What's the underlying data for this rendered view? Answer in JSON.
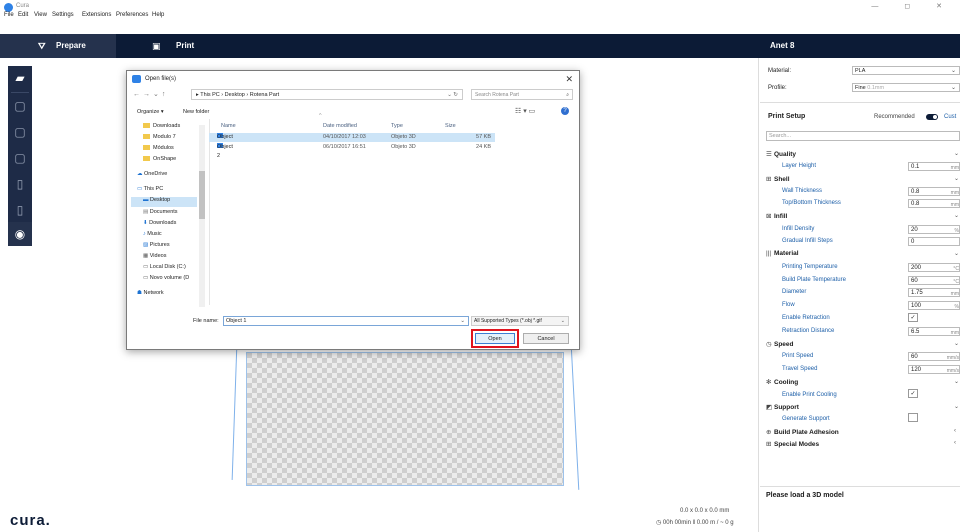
{
  "window": {
    "title": "Cura",
    "controls": "— ◻ ✕"
  },
  "menu": [
    "File",
    "Edit",
    "View",
    "Settings",
    "Extensions",
    "Preferences",
    "Help"
  ],
  "tabs": {
    "prepare": "Prepare",
    "print": "Print"
  },
  "printer": "Anet 8",
  "left_toolbar": [
    "open-file",
    "move",
    "scale",
    "rotate",
    "mirror",
    "per-model-settings",
    "view-mode"
  ],
  "panel": {
    "material_label": "Material:",
    "material_value": "PLA",
    "profile_label": "Profile:",
    "profile_value": "Fine",
    "profile_hint": "0.1mm",
    "print_setup": "Print Setup",
    "recommended": "Recommended",
    "custom": "Cust",
    "search_placeholder": "Search...",
    "categories": {
      "quality": "Quality",
      "shell": "Shell",
      "infill": "Infill",
      "material": "Material",
      "speed": "Speed",
      "cooling": "Cooling",
      "support": "Support",
      "adhesion": "Build Plate Adhesion",
      "special": "Special Modes"
    },
    "settings": {
      "layer_height": {
        "label": "Layer Height",
        "value": "0.1",
        "unit": "mm"
      },
      "wall_thickness": {
        "label": "Wall Thickness",
        "value": "0.8",
        "unit": "mm"
      },
      "topbottom": {
        "label": "Top/Bottom Thickness",
        "value": "0.8",
        "unit": "mm"
      },
      "infill_density": {
        "label": "Infill Density",
        "value": "20",
        "unit": "%"
      },
      "infill_steps": {
        "label": "Gradual Infill Steps",
        "value": "0",
        "unit": ""
      },
      "print_temp": {
        "label": "Printing Temperature",
        "value": "200",
        "unit": "°C"
      },
      "bed_temp": {
        "label": "Build Plate Temperature",
        "value": "60",
        "unit": "°C"
      },
      "diameter": {
        "label": "Diameter",
        "value": "1.75",
        "unit": "mm"
      },
      "flow": {
        "label": "Flow",
        "value": "100",
        "unit": "%"
      },
      "retraction": {
        "label": "Enable Retraction",
        "checked": true
      },
      "retract_dist": {
        "label": "Retraction Distance",
        "value": "6.5",
        "unit": "mm"
      },
      "print_speed": {
        "label": "Print Speed",
        "value": "60",
        "unit": "mm/s"
      },
      "travel_speed": {
        "label": "Travel Speed",
        "value": "120",
        "unit": "mm/s"
      },
      "cooling": {
        "label": "Enable Print Cooling",
        "checked": true
      },
      "support": {
        "label": "Generate Support",
        "checked": false
      }
    },
    "load_message": "Please load a 3D model"
  },
  "viewport": {
    "logo": "cura.",
    "dimensions": "0.0 x 0.0 x 0.0 mm",
    "estimate_time": "00h 00min",
    "estimate_material": "0.00 m / ~ 0 g"
  },
  "dialog": {
    "title": "Open file(s)",
    "path": [
      "This PC",
      "Desktop",
      "Rotena Part"
    ],
    "search_placeholder": "Search Rotena Part",
    "organize": "Organize ▾",
    "new_folder": "New folder",
    "nav_items": [
      {
        "label": "Downloads",
        "icon": "folder"
      },
      {
        "label": "Modulo 7",
        "icon": "folder"
      },
      {
        "label": "Módulos",
        "icon": "folder"
      },
      {
        "label": "OnShape",
        "icon": "folder"
      },
      {
        "label": "OneDrive",
        "icon": "cloud"
      },
      {
        "label": "This PC",
        "icon": "pc"
      },
      {
        "label": "Desktop",
        "icon": "desktop",
        "selected": true
      },
      {
        "label": "Documents",
        "icon": "documents"
      },
      {
        "label": "Downloads",
        "icon": "download"
      },
      {
        "label": "Music",
        "icon": "music"
      },
      {
        "label": "Pictures",
        "icon": "pictures"
      },
      {
        "label": "Videos",
        "icon": "videos"
      },
      {
        "label": "Local Disk (C:)",
        "icon": "disk"
      },
      {
        "label": "Novo volume (D",
        "icon": "disk"
      },
      {
        "label": "Network",
        "icon": "network"
      }
    ],
    "columns": [
      "Name",
      "Date modified",
      "Type",
      "Size"
    ],
    "files": [
      {
        "name": "Object 1",
        "date": "04/10/2017 12:03",
        "type": "Objeto 3D",
        "size": "57 KB",
        "selected": true
      },
      {
        "name": "Object 2",
        "date": "06/10/2017 16:51",
        "type": "Objeto 3D",
        "size": "24 KB",
        "selected": false
      }
    ],
    "file_name_label": "File name:",
    "file_name_value": "Object 1",
    "filter": "All Supported Types (*.obj *.gif",
    "open_label": "Open",
    "cancel_label": "Cancel"
  }
}
